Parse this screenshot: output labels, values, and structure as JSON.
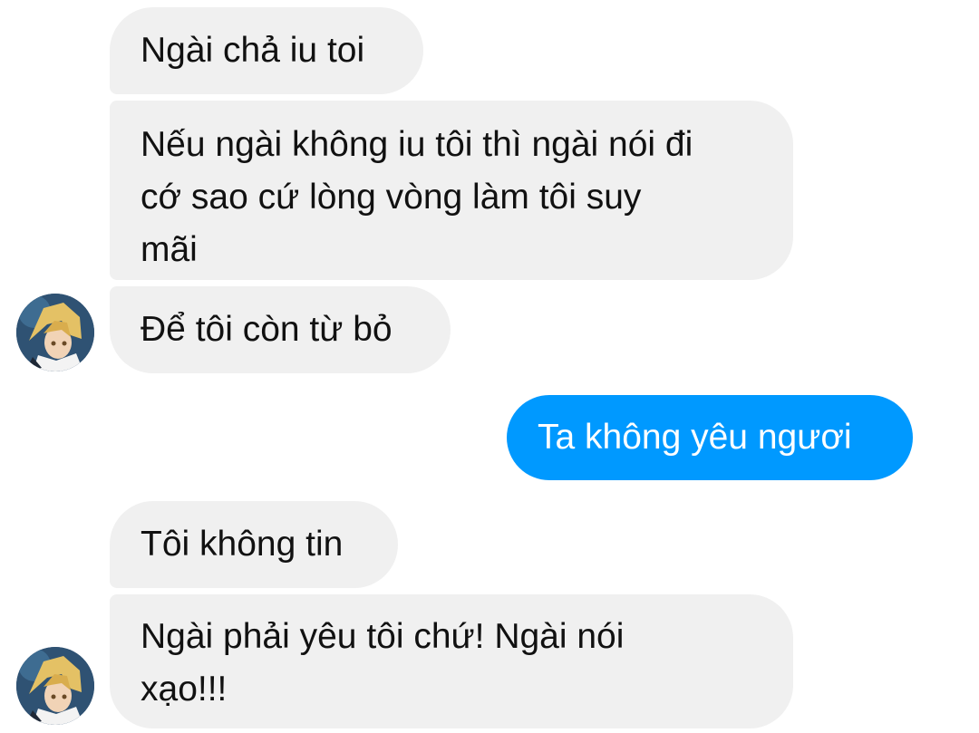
{
  "conversation": {
    "messages": [
      {
        "sender": "contact",
        "text": "Ngài chả iu toi"
      },
      {
        "sender": "contact",
        "text": "Nếu ngài không iu tôi thì ngài nói đi\ncớ sao cứ lòng vòng làm tôi suy\nmãi"
      },
      {
        "sender": "contact",
        "text": "Để tôi còn từ bỏ"
      },
      {
        "sender": "me",
        "text": "Ta không yêu ngươi"
      },
      {
        "sender": "contact",
        "text": "Tôi không tin"
      },
      {
        "sender": "contact",
        "text": "Ngài phải yêu tôi chứ! Ngài nói\nxạo!!!"
      }
    ]
  },
  "colors": {
    "incoming_bubble": "#f0f0f0",
    "outgoing_bubble": "#0099ff",
    "incoming_text": "#111111",
    "outgoing_text": "#ffffff"
  },
  "contact": {
    "avatar_icon": "avatar-icon"
  }
}
